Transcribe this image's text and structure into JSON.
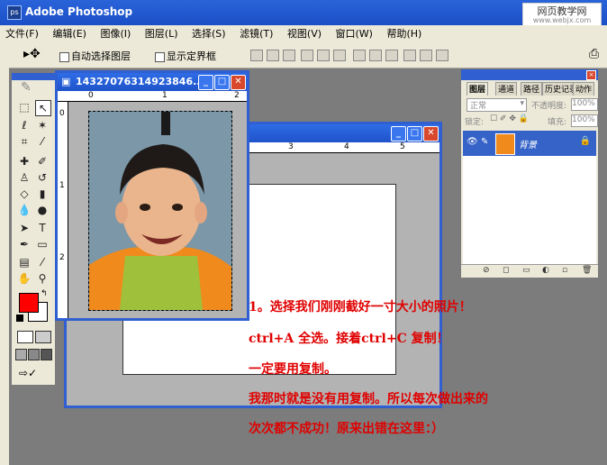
{
  "app": {
    "title": "Adobe Photoshop",
    "icon": "ps"
  },
  "site_logo": {
    "main": "网页教学网",
    "sub": "www.webjx.com"
  },
  "menu": [
    "文件(F)",
    "编辑(E)",
    "图像(I)",
    "图层(L)",
    "选择(S)",
    "滤镜(T)",
    "视图(V)",
    "窗口(W)",
    "帮助(H)"
  ],
  "options": {
    "auto_select": "自动选择图层",
    "show_bounds": "显示定界框"
  },
  "photo_window": {
    "title": "14327076314923846..."
  },
  "doc_window": {
    "ruler_marks": [
      "3",
      "4",
      "5"
    ]
  },
  "photo_ruler": {
    "h": [
      "0",
      "1",
      "2"
    ],
    "v": [
      "0",
      "1",
      "2"
    ]
  },
  "layers_panel": {
    "tabs": [
      "图层",
      "通道",
      "路径",
      "历史记录",
      "动作"
    ],
    "blend_mode": "正常",
    "opacity_label": "不透明度:",
    "opacity_value": "100%",
    "lock_label": "锁定:",
    "fill_label": "填充:",
    "fill_value": "100%",
    "layer_name": "背景"
  },
  "annotation": {
    "line1": "1。选择我们刚刚截好一寸大小的照片！",
    "line2": "ctrl+A 全选。接着ctrl+C 复制！",
    "line3": "一定要用复制。",
    "line4": "我那时就是没有用复制。所以每次做出来的",
    "line5": "次次都不成功！原来出错在这里：）"
  },
  "colors": {
    "foreground": "#ff0000",
    "background": "#ffffff",
    "xp_blue": "#2f5fd0",
    "note_red": "#e00000"
  }
}
